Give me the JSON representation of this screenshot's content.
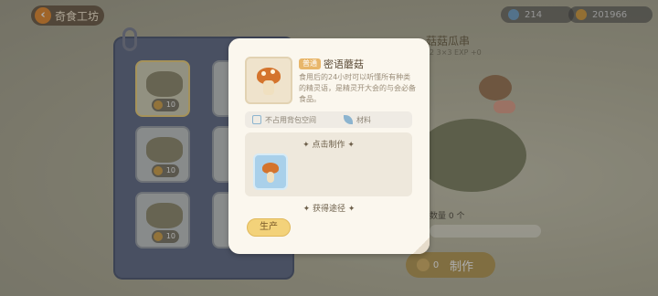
{
  "header": {
    "back_label": "奇食工坊"
  },
  "resources": [
    {
      "icon": "energy-icon",
      "value": "214"
    },
    {
      "icon": "coin-icon",
      "value": "201966"
    }
  ],
  "recipe_list": {
    "slots": [
      {
        "price": "10",
        "selected": true
      },
      {
        "price": "10",
        "selected": false
      },
      {
        "price": "10",
        "selected": false
      }
    ]
  },
  "detail": {
    "title": "菇菇瓜串",
    "stats": "2   3×3   EXP +0",
    "quantity_label": "数量  0  个",
    "make_cost": "0",
    "make_label": "制作"
  },
  "popup": {
    "rarity": "普通",
    "name": "密语蘑菇",
    "description": "食用后的24小时可以听懂所有种类的精灵语，是精灵开大会的与会必备食品。",
    "attr_storage": "不占用背包空间",
    "attr_type": "材料",
    "craft_header": "点击制作",
    "source_header": "获得途径",
    "produce_label": "生产"
  }
}
